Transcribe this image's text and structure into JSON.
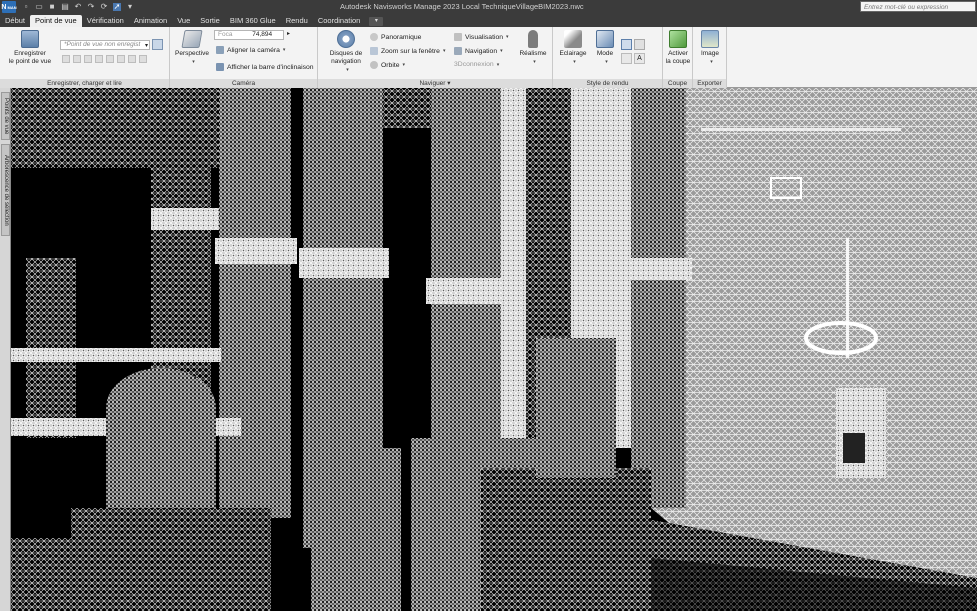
{
  "titlebar": {
    "app_button": "N",
    "app_sub": "MAN",
    "title": "Autodesk Navisworks Manage 2023    Local TechniqueVillageBIM2023.nwc",
    "search_placeholder": "Entrez mot-clé ou expression"
  },
  "tabs": [
    {
      "label": "Début"
    },
    {
      "label": "Point de vue",
      "active": true
    },
    {
      "label": "Vérification"
    },
    {
      "label": "Animation"
    },
    {
      "label": "Vue"
    },
    {
      "label": "Sortie"
    },
    {
      "label": "BIM 360 Glue"
    },
    {
      "label": "Rendu"
    },
    {
      "label": "Coordination"
    }
  ],
  "ribbon": {
    "save_panel": {
      "title": "Enregistrer, charger et lire",
      "save_button": "Enregistrer\nle point de vue",
      "viewpoint_field": "*Point de vue non enregist"
    },
    "camera_panel": {
      "title": "Caméra",
      "perspective_button": "Perspective",
      "focal_label": "Foca",
      "focal_value": "74,894",
      "align_camera": "Aligner la caméra",
      "show_tilt_bar": "Afficher la barre d'inclinaison"
    },
    "navigate_panel": {
      "title": "Naviguer",
      "steering_wheels": "Disques de\nnavigation",
      "pan": "Panoramique",
      "zoom_window": "Zoom sur la fenêtre",
      "orbit": "Orbite",
      "look_around": "Visualisation",
      "navigation": "Navigation",
      "connexion_3d": "3Dconnexion",
      "realism": "Réalisme"
    },
    "render_style_panel": {
      "title": "Style de rendu",
      "lighting": "Eclairage",
      "mode": "Mode"
    },
    "section_panel": {
      "title": "Coupe",
      "enable_section": "Activer\nla coupe"
    },
    "export_panel": {
      "title": "Exporter",
      "image": "Image"
    }
  },
  "side_tabs": {
    "saved_viewpoints": "Points de vue",
    "selection_tree": "Arborescence de sélection"
  },
  "colors": {
    "accent_blue": "#2d6fb7",
    "titlebar": "#3b3b3b",
    "ribbon_bg": "#f3f3f3"
  }
}
